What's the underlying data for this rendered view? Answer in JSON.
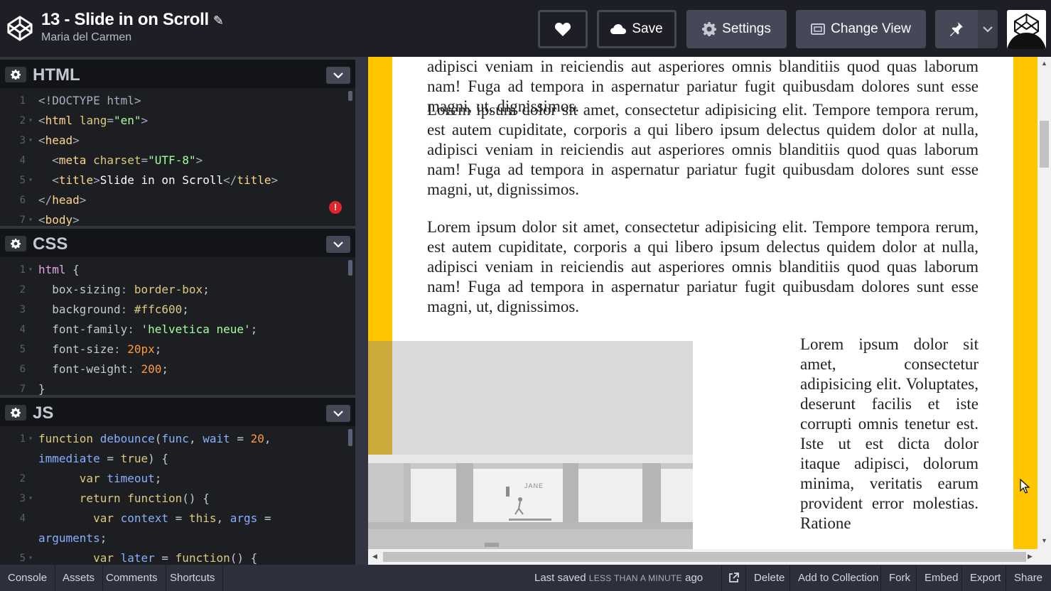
{
  "header": {
    "title": "13 - Slide in on Scroll",
    "author": "Maria del Carmen",
    "buttons": {
      "save": "Save",
      "settings": "Settings",
      "change_view": "Change View"
    }
  },
  "editors": {
    "html": {
      "title": "HTML",
      "lines": [
        {
          "n": "1",
          "fold": "",
          "parts": [
            [
              "tag",
              "<!DOCTYPE html>"
            ]
          ]
        },
        {
          "n": "2",
          "fold": "▾",
          "parts": [
            [
              "tag",
              "<"
            ],
            [
              "tname",
              "html "
            ],
            [
              "attr",
              "lang"
            ],
            [
              "tag",
              "="
            ],
            [
              "str",
              "\"en\""
            ],
            [
              "tag",
              ">"
            ]
          ]
        },
        {
          "n": "3",
          "fold": "▾",
          "parts": [
            [
              "tag",
              "<"
            ],
            [
              "tname",
              "head"
            ],
            [
              "tag",
              ">"
            ]
          ]
        },
        {
          "n": "4",
          "fold": "",
          "parts": [
            [
              "txt",
              "  "
            ],
            [
              "tag",
              "<"
            ],
            [
              "tname",
              "meta "
            ],
            [
              "attr",
              "charset"
            ],
            [
              "tag",
              "="
            ],
            [
              "str",
              "\"UTF-8\""
            ],
            [
              "tag",
              ">"
            ]
          ]
        },
        {
          "n": "5",
          "fold": "▾",
          "parts": [
            [
              "txt",
              "  "
            ],
            [
              "tag",
              "<"
            ],
            [
              "tname",
              "title"
            ],
            [
              "tag",
              ">"
            ],
            [
              "txt",
              "Slide in on Scroll"
            ],
            [
              "tag",
              "</"
            ],
            [
              "tname",
              "title"
            ],
            [
              "tag",
              ">"
            ]
          ]
        },
        {
          "n": "6",
          "fold": "",
          "parts": [
            [
              "tag",
              "</"
            ],
            [
              "tname",
              "head"
            ],
            [
              "tag",
              ">"
            ]
          ]
        },
        {
          "n": "7",
          "fold": "▾",
          "parts": [
            [
              "tag",
              "<"
            ],
            [
              "tname",
              "body"
            ],
            [
              "tag",
              ">"
            ]
          ]
        }
      ]
    },
    "css": {
      "title": "CSS",
      "lines": [
        {
          "n": "1",
          "fold": "▾",
          "parts": [
            [
              "sel",
              "html "
            ],
            [
              "prop",
              "{"
            ]
          ]
        },
        {
          "n": "2",
          "fold": "",
          "parts": [
            [
              "prop",
              "  box-sizing"
            ],
            [
              "tag",
              ": "
            ],
            [
              "kw",
              "border-box"
            ],
            [
              "prop",
              ";"
            ]
          ]
        },
        {
          "n": "3",
          "fold": "",
          "parts": [
            [
              "prop",
              "  background"
            ],
            [
              "tag",
              ": "
            ],
            [
              "kw",
              "#ffc600"
            ],
            [
              "prop",
              ";"
            ]
          ]
        },
        {
          "n": "4",
          "fold": "",
          "parts": [
            [
              "prop",
              "  font-family"
            ],
            [
              "tag",
              ": "
            ],
            [
              "str",
              "'helvetica neue'"
            ],
            [
              "prop",
              ";"
            ]
          ]
        },
        {
          "n": "5",
          "fold": "",
          "parts": [
            [
              "prop",
              "  font-size"
            ],
            [
              "tag",
              ": "
            ],
            [
              "num",
              "20px"
            ],
            [
              "prop",
              ";"
            ]
          ]
        },
        {
          "n": "6",
          "fold": "",
          "parts": [
            [
              "prop",
              "  font-weight"
            ],
            [
              "tag",
              ": "
            ],
            [
              "num",
              "200"
            ],
            [
              "prop",
              ";"
            ]
          ]
        },
        {
          "n": "7",
          "fold": "",
          "parts": [
            [
              "prop",
              "}"
            ]
          ]
        }
      ]
    },
    "js": {
      "title": "JS",
      "lines": [
        {
          "n": "1",
          "fold": "▾",
          "parts": [
            [
              "kw",
              "function "
            ],
            [
              "vari",
              "debounce"
            ],
            [
              "prop",
              "("
            ],
            [
              "vari",
              "func"
            ],
            [
              "prop",
              ", "
            ],
            [
              "vari",
              "wait"
            ],
            [
              "prop",
              " = "
            ],
            [
              "num",
              "20"
            ],
            [
              "prop",
              ","
            ]
          ]
        },
        {
          "n": "",
          "fold": "",
          "parts": [
            [
              "vari",
              "immediate"
            ],
            [
              "prop",
              " = "
            ],
            [
              "kw",
              "true"
            ],
            [
              "prop",
              ") {"
            ]
          ]
        },
        {
          "n": "2",
          "fold": "",
          "parts": [
            [
              "prop",
              "      "
            ],
            [
              "kw",
              "var "
            ],
            [
              "vari",
              "timeout"
            ],
            [
              "prop",
              ";"
            ]
          ]
        },
        {
          "n": "3",
          "fold": "▾",
          "parts": [
            [
              "prop",
              "      "
            ],
            [
              "kw",
              "return function"
            ],
            [
              "prop",
              "() {"
            ]
          ]
        },
        {
          "n": "4",
          "fold": "",
          "parts": [
            [
              "prop",
              "        "
            ],
            [
              "kw",
              "var "
            ],
            [
              "vari",
              "context"
            ],
            [
              "prop",
              " = "
            ],
            [
              "kw",
              "this"
            ],
            [
              "prop",
              ", "
            ],
            [
              "vari",
              "args"
            ],
            [
              "prop",
              " ="
            ]
          ]
        },
        {
          "n": "",
          "fold": "",
          "parts": [
            [
              "vari",
              "arguments"
            ],
            [
              "prop",
              ";"
            ]
          ]
        },
        {
          "n": "5",
          "fold": "▾",
          "parts": [
            [
              "prop",
              "        "
            ],
            [
              "kw",
              "var "
            ],
            [
              "vari",
              "later"
            ],
            [
              "prop",
              " = "
            ],
            [
              "kw",
              "function"
            ],
            [
              "prop",
              "() {"
            ]
          ]
        }
      ]
    }
  },
  "preview": {
    "paragraphs": [
      "Lorem ipsum dolor sit amet, consectetur adipisicing elit. Tempore tempora rerum, est autem cupiditate, corporis a qui libero ipsum delectus quidem dolor at nulla, adipisci veniam in reiciendis aut asperiores omnis blanditiis quod quas laborum nam! Fuga ad tempora in aspernatur pariatur fugit quibusdam dolores sunt esse magni, ut, dignissimos.",
      "Lorem ipsum dolor sit amet, consectetur adipisicing elit. Tempore tempora rerum, est autem cupiditate, corporis a qui libero ipsum delectus quidem dolor at nulla, adipisci veniam in reiciendis aut asperiores omnis blanditiis quod quas laborum nam! Fuga ad tempora in aspernatur pariatur fugit quibusdam dolores sunt esse magni, ut, dignissimos.",
      "Lorem ipsum dolor sit amet, consectetur adipisicing elit. Tempore tempora rerum, est autem cupiditate, corporis a qui libero ipsum delectus quidem dolor at nulla, adipisci veniam in reiciendis aut asperiores omnis blanditiis quod quas laborum nam! Fuga ad tempora in aspernatur pariatur fugit quibusdam dolores sunt esse magni, ut, dignissimos."
    ],
    "side_paragraph": "Lorem ipsum dolor sit amet, consectetur adipisicing elit. Voluptates, deserunt facilis et iste corrupti omnis tenetur est. Iste ut est dicta dolor itaque adipisci, dolorum minima, veritatis earum provident error molestias. Ratione",
    "photo_sign": "JANE",
    "colors": {
      "background": "#ffc600",
      "page": "#ffffff"
    }
  },
  "footer": {
    "left": [
      "Console",
      "Assets",
      "Comments",
      "Shortcuts"
    ],
    "saved_prefix": "Last saved",
    "saved_time": "LESS THAN A MINUTE",
    "saved_suffix": "ago",
    "right": [
      "Delete",
      "Add to Collection",
      "Fork",
      "Embed",
      "Export",
      "Share"
    ]
  }
}
